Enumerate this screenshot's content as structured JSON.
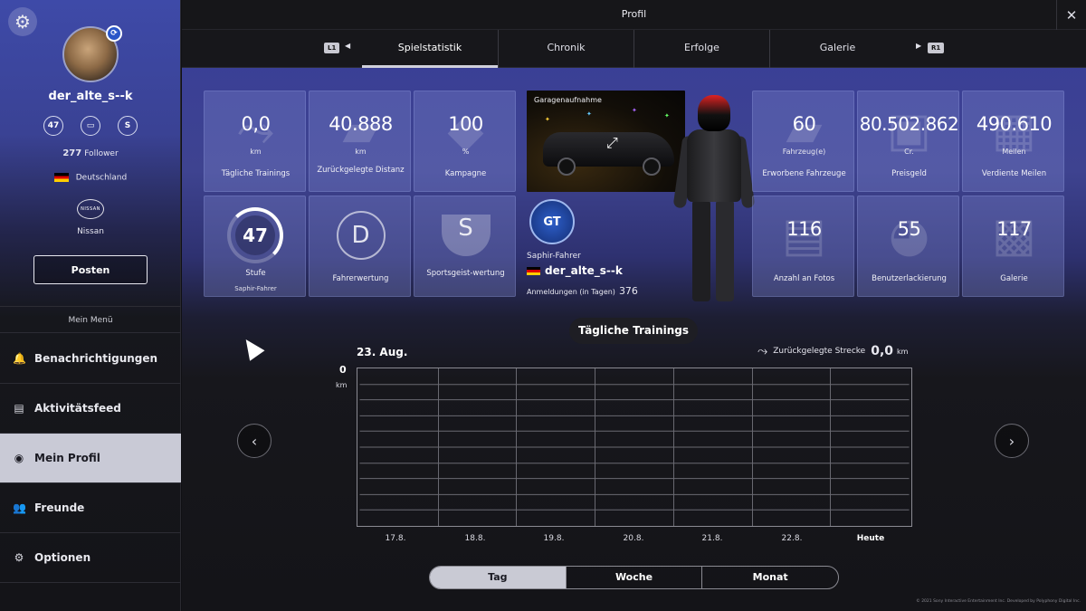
{
  "sidebar": {
    "username": "der_alte_s--k",
    "level_badge": "47",
    "follower_count": "277",
    "follower_label": "Follower",
    "country": "Deutschland",
    "brand_logo_text": "NISSAN",
    "brand": "Nissan",
    "post_button": "Posten",
    "menu_title": "Mein Menü",
    "menu": [
      {
        "label": "Benachrichtigungen",
        "icon": "bell-icon"
      },
      {
        "label": "Aktivitätsfeed",
        "icon": "feed-icon"
      },
      {
        "label": "Mein Profil",
        "icon": "profile-icon"
      },
      {
        "label": "Freunde",
        "icon": "friends-icon"
      },
      {
        "label": "Optionen",
        "icon": "gear-icon"
      }
    ]
  },
  "header": {
    "title": "Profil",
    "l1": "L1",
    "r1": "R1",
    "tabs": [
      "Spielstatistik",
      "Chronik",
      "Erfolge",
      "Galerie"
    ]
  },
  "tiles": {
    "daily": {
      "value": "0,0",
      "unit": "km",
      "label": "Tägliche Trainings"
    },
    "distance": {
      "value": "40.888",
      "unit": "km",
      "label": "Zurückgelegte Distanz"
    },
    "campaign": {
      "value": "100",
      "unit": "%",
      "label": "Kampagne"
    },
    "level": {
      "value": "47",
      "label": "Stufe",
      "sub": "Saphir-Fahrer"
    },
    "driver_rating": {
      "label": "Fahrerwertung",
      "icon_text": "D"
    },
    "sport_rating": {
      "label": "Sportsgeist-wertung",
      "icon_text": "S"
    },
    "cars": {
      "value": "60",
      "unit": "Fahrzeug(e)",
      "label": "Erworbene Fahrzeuge"
    },
    "prize": {
      "value": "80.502.862",
      "unit": "Cr.",
      "label": "Preisgeld"
    },
    "miles": {
      "value": "490.610",
      "unit": "Meilen",
      "label": "Verdiente Meilen"
    },
    "photos": {
      "value": "116",
      "label": "Anzahl an Fotos"
    },
    "livery": {
      "value": "55",
      "label": "Benutzerlackierung"
    },
    "gallery": {
      "value": "117",
      "label": "Galerie"
    }
  },
  "garage": {
    "title": "Garagenaufnahme"
  },
  "profile_card": {
    "badge_text": "GT",
    "rank_name": "Saphir-Fahrer",
    "username": "der_alte_s--k",
    "logins_label": "Anmeldungen (in Tagen)",
    "logins_value": "376"
  },
  "chart": {
    "title": "Tägliche Trainings",
    "date": "23. Aug.",
    "legend_label": "Zurückgelegte Strecke",
    "legend_value": "0,0",
    "legend_unit": "km",
    "y_max": "0",
    "y_unit": "km",
    "x_labels": [
      "17.8.",
      "18.8.",
      "19.8.",
      "20.8.",
      "21.8.",
      "22.8.",
      "Heute"
    ],
    "periods": [
      "Tag",
      "Woche",
      "Monat"
    ]
  },
  "chart_data": {
    "type": "line",
    "title": "Tägliche Trainings",
    "categories": [
      "17.8.",
      "18.8.",
      "19.8.",
      "20.8.",
      "21.8.",
      "22.8.",
      "Heute"
    ],
    "values": [
      0,
      0,
      0,
      0,
      0,
      0,
      0
    ],
    "ylabel": "km",
    "ylim": [
      0,
      0
    ],
    "grid": true
  },
  "footer": {
    "copyright": "© 2021 Sony Interactive Entertainment Inc. Developed by Polyphony Digital Inc."
  }
}
